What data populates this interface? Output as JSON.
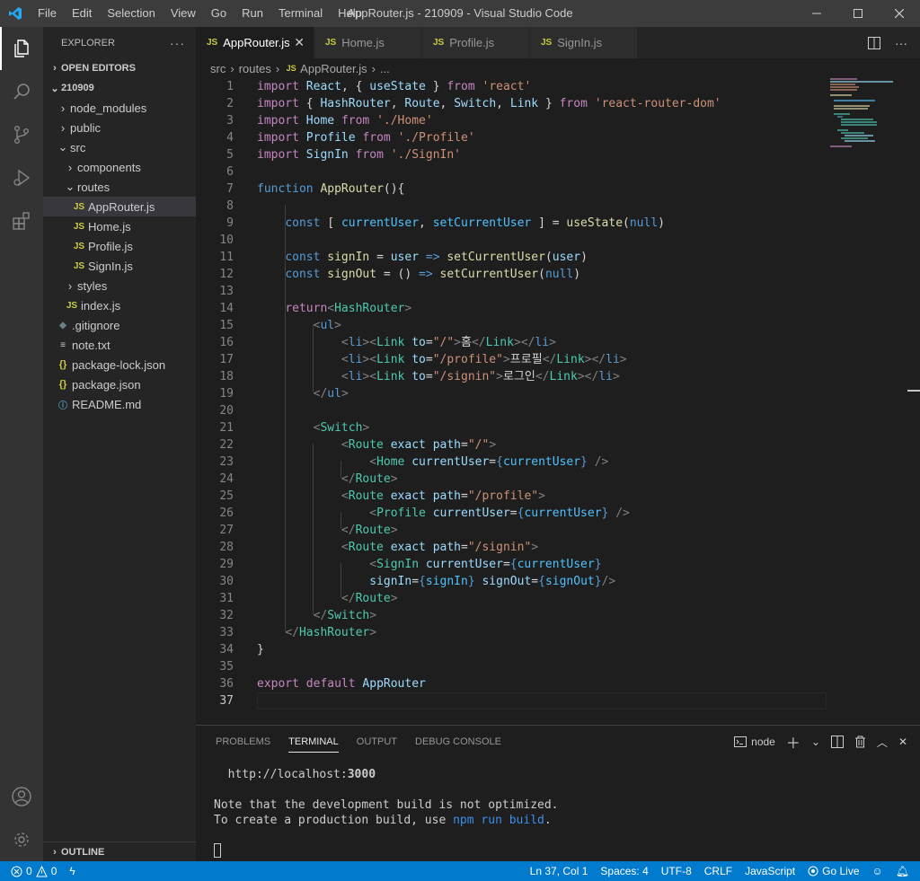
{
  "titlebar": {
    "menu": [
      "File",
      "Edit",
      "Selection",
      "View",
      "Go",
      "Run",
      "Terminal",
      "Help"
    ],
    "title": "AppRouter.js - 210909 - Visual Studio Code"
  },
  "sidebar": {
    "header": "EXPLORER",
    "open_editors": "OPEN EDITORS",
    "project": "210909",
    "items": [
      {
        "label": "node_modules"
      },
      {
        "label": "public"
      },
      {
        "label": "src"
      },
      {
        "label": "components"
      },
      {
        "label": "routes"
      },
      {
        "label": "AppRouter.js",
        "icon": "JS"
      },
      {
        "label": "Home.js",
        "icon": "JS"
      },
      {
        "label": "Profile.js",
        "icon": "JS"
      },
      {
        "label": "SignIn.js",
        "icon": "JS"
      },
      {
        "label": "styles"
      },
      {
        "label": "index.js",
        "icon": "JS"
      },
      {
        "label": ".gitignore"
      },
      {
        "label": "note.txt"
      },
      {
        "label": "package-lock.json",
        "icon": "{}"
      },
      {
        "label": "package.json",
        "icon": "{}"
      },
      {
        "label": "README.md"
      }
    ],
    "outline": "OUTLINE"
  },
  "tabs": [
    {
      "label": "AppRouter.js",
      "icon": "JS"
    },
    {
      "label": "Home.js",
      "icon": "JS"
    },
    {
      "label": "Profile.js",
      "icon": "JS"
    },
    {
      "label": "SignIn.js",
      "icon": "JS"
    }
  ],
  "breadcrumb": [
    "src",
    "routes",
    "AppRouter.js",
    "..."
  ],
  "editor": {
    "line_numbers": [
      "1",
      "2",
      "3",
      "4",
      "5",
      "6",
      "7",
      "8",
      "9",
      "10",
      "11",
      "12",
      "13",
      "14",
      "15",
      "16",
      "17",
      "18",
      "19",
      "20",
      "21",
      "22",
      "23",
      "24",
      "25",
      "26",
      "27",
      "28",
      "29",
      "30",
      "31",
      "32",
      "33",
      "34",
      "35",
      "36",
      "37"
    ],
    "code": {
      "import_kw": "import",
      "from_kw": "from",
      "react": "React",
      "useState": "useState",
      "react_src": "'react'",
      "hashrouter": "HashRouter",
      "route": "Route",
      "switch": "Switch",
      "link": "Link",
      "rrd_src": "'react-router-dom'",
      "home": "Home",
      "home_src": "'./Home'",
      "profile": "Profile",
      "profile_src": "'./Profile'",
      "signin": "SignIn",
      "signin_src": "'./SignIn'",
      "function_kw": "function",
      "approuter": "AppRouter",
      "const_kw": "const",
      "currentUser": "currentUser",
      "setCurrentUser": "setCurrentUser",
      "null_kw": "null",
      "signIn": "signIn",
      "signOut": "signOut",
      "user": "user",
      "return_kw": "return",
      "ul": "ul",
      "li": "li",
      "to": "to",
      "exact": "exact",
      "path": "path",
      "path_root": "\"/\"",
      "path_profile": "\"/profile\"",
      "path_signin": "\"/signin\"",
      "txt_home": "홈",
      "txt_profile": "프로필",
      "txt_login": "로그인",
      "export_kw": "export",
      "default_kw": "default"
    }
  },
  "panel": {
    "tabs": [
      "PROBLEMS",
      "TERMINAL",
      "OUTPUT",
      "DEBUG CONSOLE"
    ],
    "terminal_name": "node",
    "terminal": {
      "url_prefix": "http://localhost:",
      "port": "3000",
      "note1": "Note that the development build is not optimized.",
      "note2_prefix": "To create a production build, use ",
      "note2_cmd": "npm run build",
      "note2_suffix": "."
    }
  },
  "statusbar": {
    "errors": "0",
    "warnings": "0",
    "position": "Ln 37, Col 1",
    "spaces": "Spaces: 4",
    "encoding": "UTF-8",
    "eol": "CRLF",
    "language": "JavaScript",
    "golive": "Go Live"
  },
  "colors": {
    "accent": "#007acc",
    "titlebar": "#3c3c3c",
    "activitybar": "#333333",
    "sidebar": "#252526",
    "editor": "#1e1e1e"
  }
}
